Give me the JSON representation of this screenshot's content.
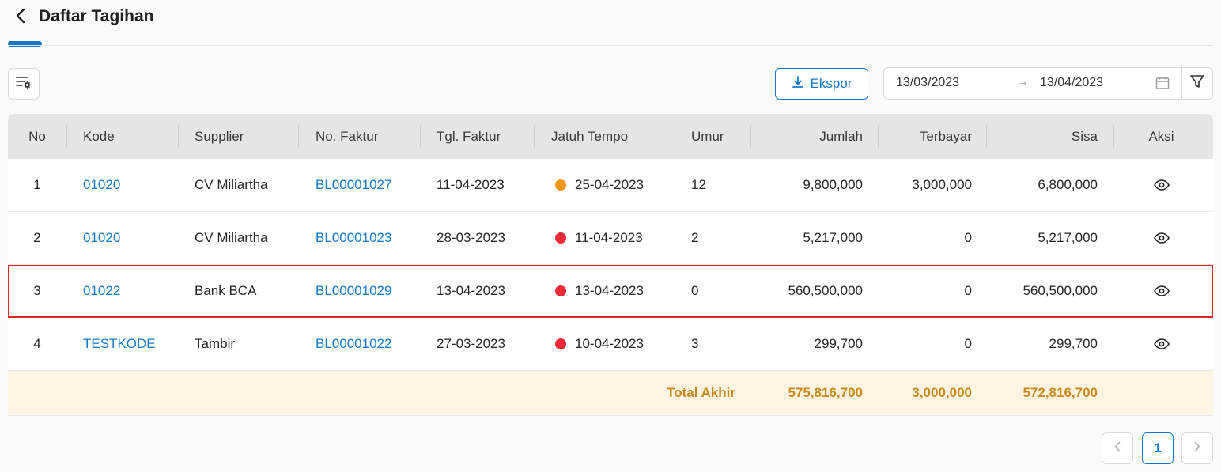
{
  "page": {
    "title": "Daftar Tagihan"
  },
  "toolbar": {
    "export_label": "Ekspor",
    "date_from": "13/03/2023",
    "date_to": "13/04/2023",
    "range_arrow": "→"
  },
  "table": {
    "columns": [
      "No",
      "Kode",
      "Supplier",
      "No. Faktur",
      "Tgl. Faktur",
      "Jatuh Tempo",
      "Umur",
      "Jumlah",
      "Terbayar",
      "Sisa",
      "Aksi"
    ],
    "rows": [
      {
        "no": "1",
        "kode": "01020",
        "supplier": "CV Miliartha",
        "faktur": "BL00001027",
        "tgl": "11-04-2023",
        "status_color": "#f0961a",
        "tempo": "25-04-2023",
        "umur": "12",
        "jumlah": "9,800,000",
        "terbayar": "3,000,000",
        "sisa": "6,800,000"
      },
      {
        "no": "2",
        "kode": "01020",
        "supplier": "CV Miliartha",
        "faktur": "BL00001023",
        "tgl": "28-03-2023",
        "status_color": "#ee2a37",
        "tempo": "11-04-2023",
        "umur": "2",
        "jumlah": "5,217,000",
        "terbayar": "0",
        "sisa": "5,217,000"
      },
      {
        "no": "3",
        "kode": "01022",
        "supplier": "Bank BCA",
        "faktur": "BL00001029",
        "tgl": "13-04-2023",
        "status_color": "#ee2a37",
        "tempo": "13-04-2023",
        "umur": "0",
        "jumlah": "560,500,000",
        "terbayar": "0",
        "sisa": "560,500,000"
      },
      {
        "no": "4",
        "kode": "TESTKODE",
        "supplier": "Tambir",
        "faktur": "BL00001022",
        "tgl": "27-03-2023",
        "status_color": "#ee2a37",
        "tempo": "10-04-2023",
        "umur": "3",
        "jumlah": "299,700",
        "terbayar": "0",
        "sisa": "299,700"
      }
    ],
    "total": {
      "label": "Total Akhir",
      "jumlah": "575,816,700",
      "terbayar": "3,000,000",
      "sisa": "572,816,700"
    }
  },
  "pagination": {
    "current": "1"
  },
  "colors": {
    "accent": "#1677c9",
    "highlight_border": "#e02424",
    "total_text": "#c88a14",
    "total_bg": "#fdf4e4"
  }
}
